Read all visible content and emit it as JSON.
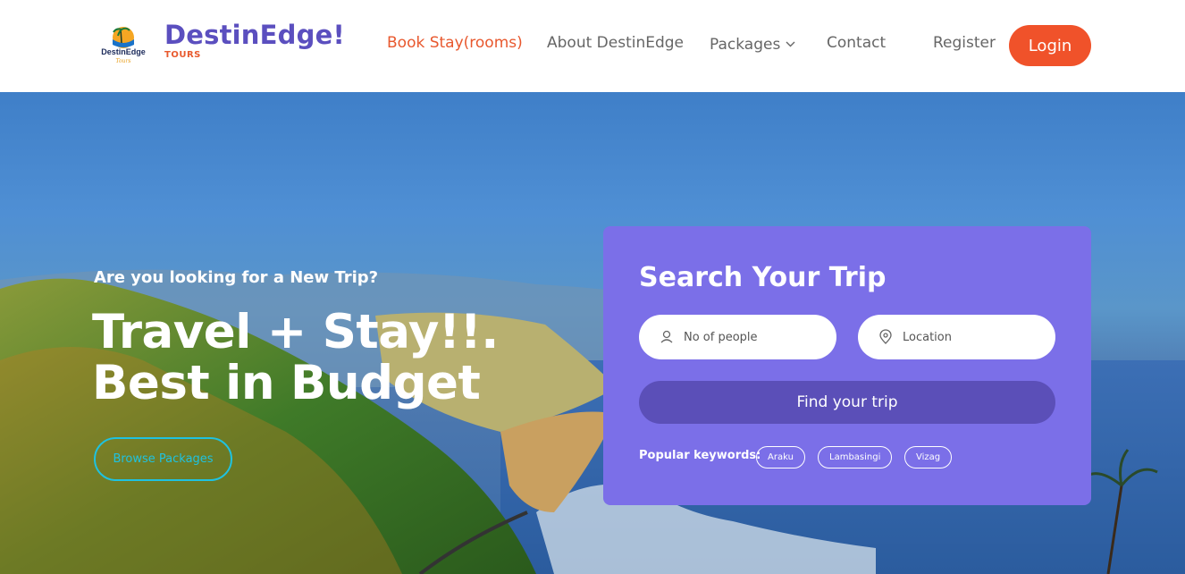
{
  "brand": {
    "name": "DestinEdge!",
    "sub": "TOURS",
    "logo_text": "DestinEdge",
    "logo_tag": "Tours"
  },
  "nav": {
    "items": [
      {
        "label": "Book Stay(rooms)",
        "active": true
      },
      {
        "label": "About DestinEdge",
        "active": false
      },
      {
        "label": "Packages",
        "active": false,
        "has_dropdown": true
      },
      {
        "label": "Contact",
        "active": false
      }
    ],
    "register_label": "Register",
    "login_label": "Login"
  },
  "hero": {
    "kicker": "Are you looking for a New Trip?",
    "headline_line1": "Travel + Stay!!.",
    "headline_line2": "Best in Budget",
    "browse_label": "Browse Packages"
  },
  "search": {
    "title": "Search Your Trip",
    "people_placeholder": "No of people",
    "location_placeholder": "Location",
    "find_label": "Find your trip",
    "keywords_label": "Popular keywords:",
    "keywords": [
      "Araku",
      "Lambasingi",
      "Vizag"
    ]
  },
  "colors": {
    "accent": "#f0522a",
    "brand_purple": "#5b4fbf",
    "card": "#7b6fe8",
    "find_button": "#5b4fb8",
    "browse_outline": "#1fc2e0"
  },
  "icons": {
    "people": "user-icon",
    "location": "map-pin-icon",
    "dropdown": "chevron-down-icon"
  }
}
